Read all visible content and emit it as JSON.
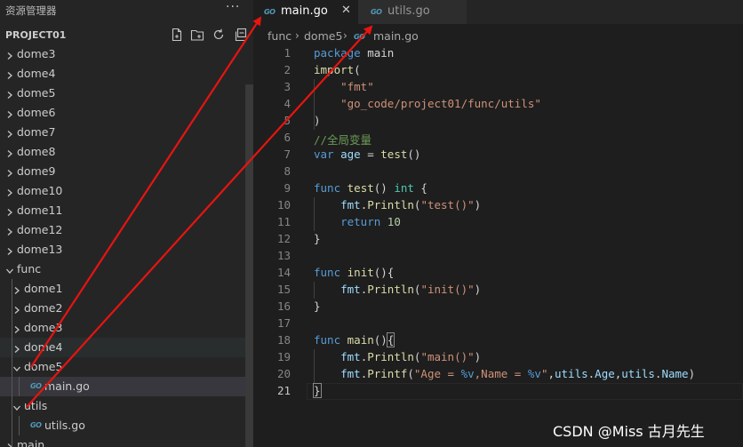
{
  "sidebar": {
    "title": "资源管理器",
    "more": "···",
    "section": "PROJECT01",
    "actions": [
      "new-file-icon",
      "new-folder-icon",
      "refresh-icon",
      "collapse-all-icon"
    ],
    "tree": [
      {
        "label": "dome3",
        "depth": 0,
        "kind": "folder",
        "open": false
      },
      {
        "label": "dome4",
        "depth": 0,
        "kind": "folder",
        "open": false
      },
      {
        "label": "dome5",
        "depth": 0,
        "kind": "folder",
        "open": false
      },
      {
        "label": "dome6",
        "depth": 0,
        "kind": "folder",
        "open": false
      },
      {
        "label": "dome7",
        "depth": 0,
        "kind": "folder",
        "open": false
      },
      {
        "label": "dome8",
        "depth": 0,
        "kind": "folder",
        "open": false
      },
      {
        "label": "dome9",
        "depth": 0,
        "kind": "folder",
        "open": false
      },
      {
        "label": "dome10",
        "depth": 0,
        "kind": "folder",
        "open": false
      },
      {
        "label": "dome11",
        "depth": 0,
        "kind": "folder",
        "open": false
      },
      {
        "label": "dome12",
        "depth": 0,
        "kind": "folder",
        "open": false
      },
      {
        "label": "dome13",
        "depth": 0,
        "kind": "folder",
        "open": false
      },
      {
        "label": "func",
        "depth": 0,
        "kind": "folder",
        "open": true
      },
      {
        "label": "dome1",
        "depth": 1,
        "kind": "folder",
        "open": false
      },
      {
        "label": "dome2",
        "depth": 1,
        "kind": "folder",
        "open": false
      },
      {
        "label": "dome3",
        "depth": 1,
        "kind": "folder",
        "open": false
      },
      {
        "label": "dome4",
        "depth": 1,
        "kind": "folder",
        "open": false,
        "state": "hover"
      },
      {
        "label": "dome5",
        "depth": 1,
        "kind": "folder",
        "open": true
      },
      {
        "label": "main.go",
        "depth": 2,
        "kind": "go",
        "state": "selected"
      },
      {
        "label": "utils",
        "depth": 1,
        "kind": "folder",
        "open": true
      },
      {
        "label": "utils.go",
        "depth": 2,
        "kind": "go"
      },
      {
        "label": "main",
        "depth": 0,
        "kind": "folder",
        "open": false
      }
    ]
  },
  "tabs": [
    {
      "label": "main.go",
      "icon": "GO",
      "active": true,
      "close": "✕"
    },
    {
      "label": "utils.go",
      "icon": "GO",
      "active": false
    }
  ],
  "breadcrumb": [
    "func",
    "dome5",
    "main.go"
  ],
  "breadcrumb_icon": "GO",
  "editor": {
    "active_line": 21,
    "lines": [
      [
        [
          "kw",
          "package"
        ],
        [
          "p",
          " main"
        ]
      ],
      [
        [
          "fn",
          "import"
        ],
        [
          "p",
          "("
        ]
      ],
      [
        [
          "p",
          "    "
        ],
        [
          "str",
          "\"fmt\""
        ]
      ],
      [
        [
          "p",
          "    "
        ],
        [
          "str",
          "\"go_code/project01/func/utils\""
        ]
      ],
      [
        [
          "p",
          ")"
        ]
      ],
      [
        [
          "cmt",
          "//全局变量"
        ]
      ],
      [
        [
          "kw",
          "var"
        ],
        [
          "p",
          " "
        ],
        [
          "id",
          "age"
        ],
        [
          "p",
          " = "
        ],
        [
          "fn",
          "test"
        ],
        [
          "p",
          "()"
        ]
      ],
      [],
      [
        [
          "kw",
          "func"
        ],
        [
          "p",
          " "
        ],
        [
          "fn",
          "test"
        ],
        [
          "p",
          "() "
        ],
        [
          "ty",
          "int"
        ],
        [
          "p",
          " {"
        ]
      ],
      [
        [
          "p",
          "    "
        ],
        [
          "id",
          "fmt"
        ],
        [
          "p",
          "."
        ],
        [
          "fn",
          "Println"
        ],
        [
          "p",
          "("
        ],
        [
          "str",
          "\"test()\""
        ],
        [
          "p",
          ")"
        ]
      ],
      [
        [
          "p",
          "    "
        ],
        [
          "kw",
          "return"
        ],
        [
          "p",
          " "
        ],
        [
          "num",
          "10"
        ]
      ],
      [
        [
          "p",
          "}"
        ]
      ],
      [],
      [
        [
          "kw",
          "func"
        ],
        [
          "p",
          " "
        ],
        [
          "fn",
          "init"
        ],
        [
          "p",
          "(){"
        ]
      ],
      [
        [
          "p",
          "    "
        ],
        [
          "id",
          "fmt"
        ],
        [
          "p",
          "."
        ],
        [
          "fn",
          "Println"
        ],
        [
          "p",
          "("
        ],
        [
          "str",
          "\"init()\""
        ],
        [
          "p",
          ")"
        ]
      ],
      [
        [
          "p",
          "}"
        ]
      ],
      [],
      [
        [
          "kw",
          "func"
        ],
        [
          "p",
          " "
        ],
        [
          "fn",
          "main"
        ],
        [
          "p",
          "()"
        ],
        [
          "brk",
          "{"
        ]
      ],
      [
        [
          "p",
          "    "
        ],
        [
          "id",
          "fmt"
        ],
        [
          "p",
          "."
        ],
        [
          "fn",
          "Println"
        ],
        [
          "p",
          "("
        ],
        [
          "str",
          "\"main()\""
        ],
        [
          "p",
          ")"
        ]
      ],
      [
        [
          "p",
          "    "
        ],
        [
          "id",
          "fmt"
        ],
        [
          "p",
          "."
        ],
        [
          "fn",
          "Printf"
        ],
        [
          "p",
          "("
        ],
        [
          "str",
          "\"Age = "
        ],
        [
          "pct",
          "%v"
        ],
        [
          "str",
          ",Name = "
        ],
        [
          "pct",
          "%v"
        ],
        [
          "str",
          "\""
        ],
        [
          "p",
          ","
        ],
        [
          "id",
          "utils"
        ],
        [
          "p",
          "."
        ],
        [
          "id",
          "Age"
        ],
        [
          "p",
          ","
        ],
        [
          "id",
          "utils"
        ],
        [
          "p",
          "."
        ],
        [
          "id",
          "Name"
        ],
        [
          "p",
          ")"
        ]
      ],
      [
        [
          "brk",
          "}"
        ]
      ]
    ]
  },
  "watermark": "CSDN @Miss 古月先生",
  "colors": {
    "annotation_arrow": "#e8140f",
    "go_icon": "#519aba",
    "editor_bg": "#1e1e1e",
    "sidebar_bg": "#252526"
  }
}
